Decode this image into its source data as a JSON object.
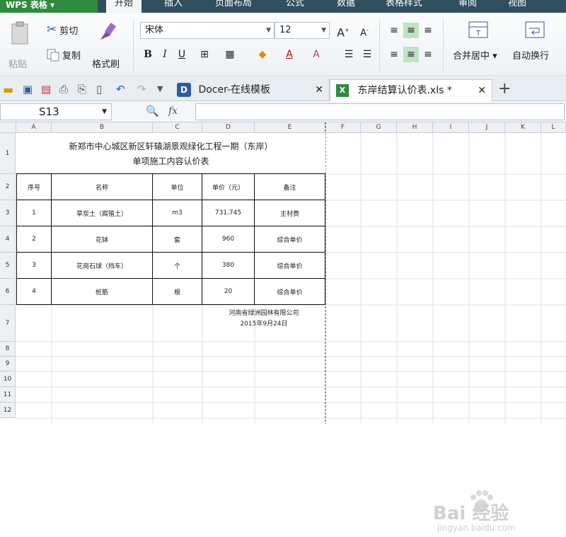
{
  "app": {
    "name": "WPS 表格"
  },
  "menu": {
    "tabs": [
      "开始",
      "插入",
      "页面布局",
      "公式",
      "数据",
      "表格样式",
      "审阅",
      "视图"
    ],
    "active": "开始"
  },
  "ribbon": {
    "paste": "粘贴",
    "cut": "剪切",
    "copy": "复制",
    "format_painter": "格式刷",
    "font_name": "宋体",
    "font_size": "12",
    "merge_center": "合并居中",
    "wrap_text": "自动换行"
  },
  "tabs": [
    {
      "label": "Docer-在线模板"
    },
    {
      "label": "东岸结算认价表.xls *"
    }
  ],
  "formula_bar": {
    "cell_ref": "S13",
    "fx": "fx",
    "value": ""
  },
  "columns": [
    "A",
    "B",
    "C",
    "D",
    "E",
    "F",
    "G",
    "H",
    "I",
    "J",
    "K",
    "L"
  ],
  "rows": [
    "1",
    "2",
    "3",
    "4",
    "5",
    "6",
    "7",
    "8",
    "9",
    "10",
    "11",
    "12"
  ],
  "sheet": {
    "title_line1": "新郑市中心城区新区轩辕湖景观绿化工程一期（东岸）",
    "title_line2": "单项施工内容认价表",
    "headers": [
      "序号",
      "名称",
      "单位",
      "单价（元）",
      "备注"
    ],
    "data_rows": [
      [
        "1",
        "草炭土（腐殖土）",
        "m3",
        "731.745",
        "主材费"
      ],
      [
        "2",
        "花钵",
        "套",
        "960",
        "综合单价"
      ],
      [
        "3",
        "花岗石球（挡车）",
        "个",
        "380",
        "综合单价"
      ],
      [
        "4",
        "桩筋",
        "根",
        "20",
        "综合单价"
      ]
    ],
    "company": "河南省绿洲园林有限公司",
    "date": "2015年9月24日"
  },
  "watermark": {
    "brand": "Bai 经验",
    "url": "jingyan.baidu.com"
  },
  "colors": {
    "accent_green": "#2e8b3d",
    "menubar": "#2f4f5f"
  }
}
